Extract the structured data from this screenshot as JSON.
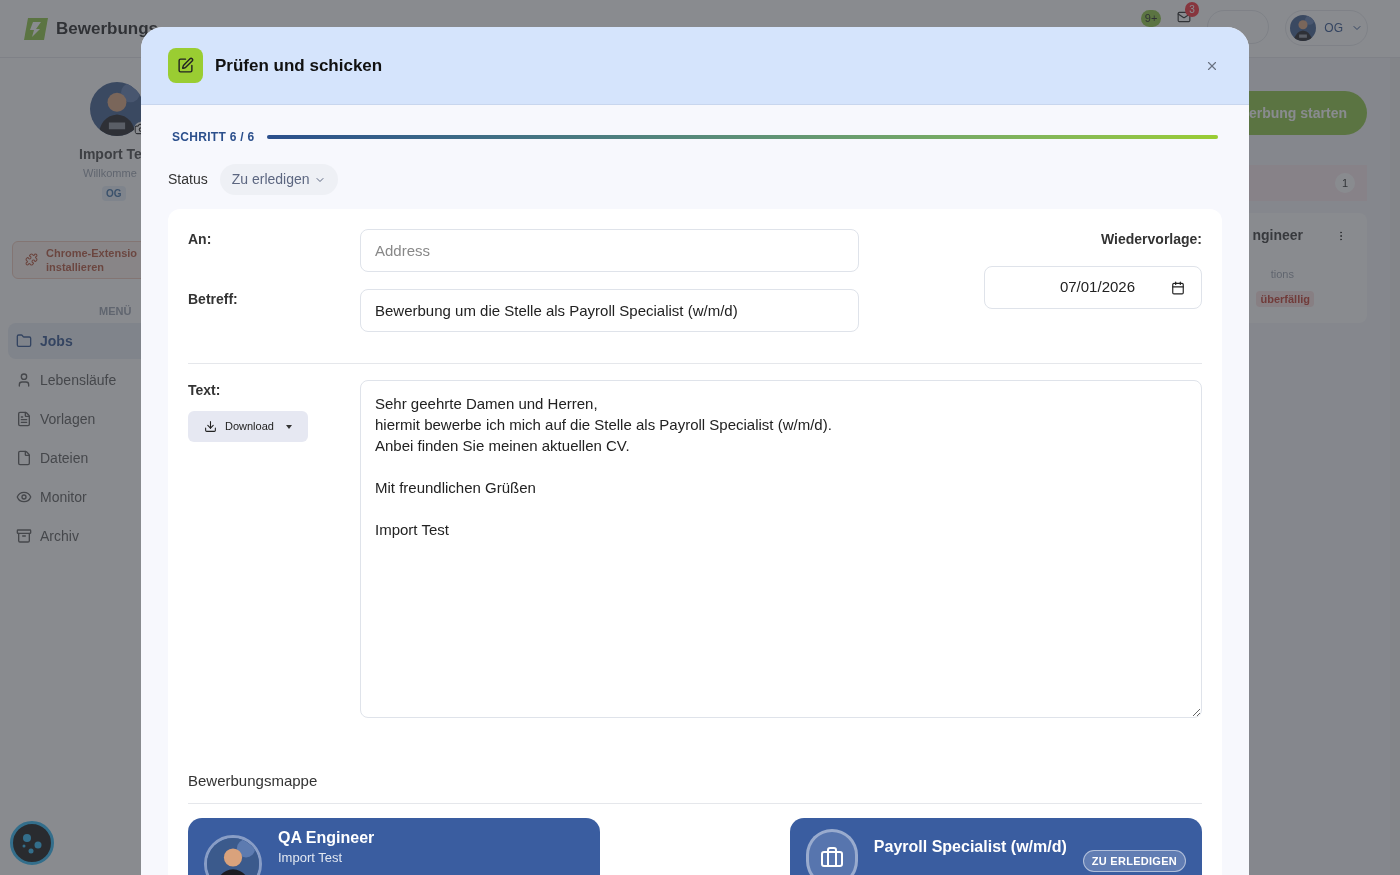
{
  "header": {
    "logo_text": "Bewerbungs",
    "notifications_badge": "9+",
    "messages_badge": "3",
    "user_initials": "OG"
  },
  "sidebar": {
    "profile_name": "Import Te",
    "greeting": "Willkomme",
    "initials": "OG",
    "extension_lines": [
      "Chrome-Extensio",
      "installieren"
    ],
    "menu_label": "MENÜ",
    "items": [
      {
        "label": "Jobs",
        "kind": "folder",
        "selected": true
      },
      {
        "label": "Lebensläufe",
        "kind": "user",
        "selected": false
      },
      {
        "label": "Vorlagen",
        "kind": "template",
        "selected": false
      },
      {
        "label": "Dateien",
        "kind": "file",
        "selected": false
      },
      {
        "label": "Monitor",
        "kind": "monitor",
        "selected": false
      },
      {
        "label": "Archiv",
        "kind": "archive",
        "selected": false
      }
    ]
  },
  "background": {
    "start_button": "erbung starten",
    "column_count": "1",
    "card_title": "ngineer",
    "card_subtitle": "tions",
    "card_tag": "überfällig"
  },
  "modal": {
    "title": "Prüfen und schicken",
    "step_label": "SCHRITT 6 / 6",
    "progress": {
      "level": 1
    },
    "status_label": "Status",
    "status_value": "Zu erledigen",
    "to_label": "An:",
    "to_placeholder": "Address",
    "subject_label": "Betreff:",
    "subject_value": "Bewerbung um die Stelle als Payroll Specialist (w/m/d)",
    "followup_label": "Wiedervorlage:",
    "followup_date": "07/01/2026",
    "text_label": "Text:",
    "download_button": "Download",
    "body": "Sehr geehrte Damen und Herren,\nhiermit bewerbe ich mich auf die Stelle als Payroll Specialist (w/m/d).\nAnbei finden Sie meinen aktuellen CV.\n\nMit freundlichen Grüßen\n\nImport Test",
    "portfolio_title": "Bewerbungsmappe",
    "cards": [
      {
        "kind": "cv",
        "title": "QA Engineer",
        "subtitle": "Import Test"
      },
      {
        "kind": "job",
        "title": "Payroll Specialist (w/m/d)",
        "badge": "ZU ERLEDIGEN"
      }
    ]
  }
}
